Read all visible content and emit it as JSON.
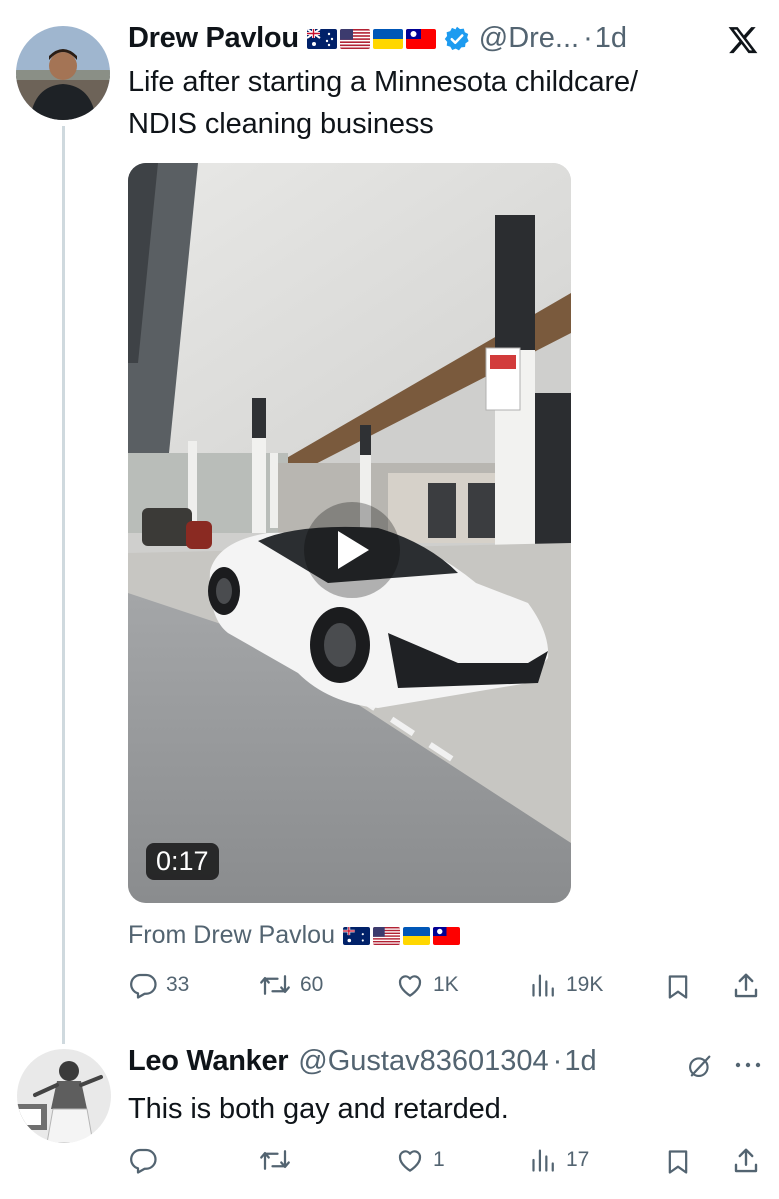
{
  "tweet": {
    "author_name": "Drew Pavlou",
    "flags": [
      "australia-flag",
      "usa-flag",
      "ukraine-flag",
      "taiwan-flag"
    ],
    "handle": "@Dre...",
    "separator": "·",
    "time": "1d",
    "text_line1": "Life after starting a Minnesota childcare/",
    "text_line2": "NDIS cleaning business",
    "video_duration": "0:17",
    "from_label": "From Drew Pavlou",
    "replies": "33",
    "retweets": "60",
    "likes": "1K",
    "views": "19K"
  },
  "reply": {
    "author_name": "Leo Wanker",
    "handle": "@Gustav83601304",
    "separator": "·",
    "time": "1d",
    "text": "This is both gay and retarded.",
    "replies": "",
    "retweets": "",
    "likes": "1",
    "views": "17"
  },
  "icons": {
    "verified": "verified-badge-icon",
    "x_logo": "x-logo-icon",
    "grok": "grok-icon",
    "more": "more-icon",
    "reply": "reply-icon",
    "retweet": "retweet-icon",
    "like": "like-icon",
    "views": "views-icon",
    "bookmark": "bookmark-icon",
    "share": "share-icon"
  },
  "colors": {
    "text": "#0f1419",
    "muted": "#536471",
    "verified": "#1d9bf0",
    "thread_line": "#cfd9de"
  }
}
